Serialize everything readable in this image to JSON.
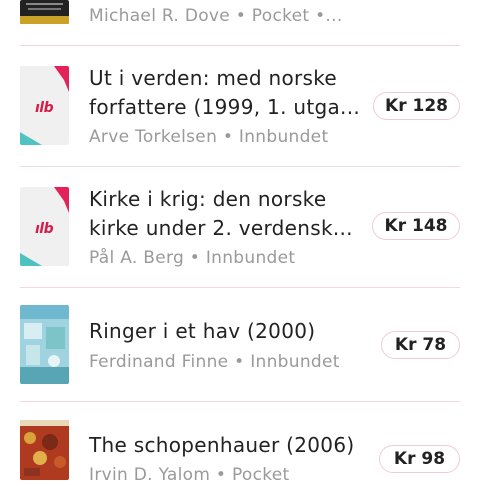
{
  "colors": {
    "accent": "#e3225a",
    "teal": "#4ec1c1",
    "divider": "#f7d7de"
  },
  "items": [
    {
      "title": "",
      "author": "Michael R. Dove",
      "format": "Pocket",
      "suffix": "•...",
      "price": ""
    },
    {
      "title": "Ut i verden: med norske forfattere (1999, 1. utga...",
      "author": "Arve Torkelsen",
      "format": "Innbundet",
      "price": "Kr 128",
      "cover_logo": "ılb"
    },
    {
      "title": "Kirke i krig: den norske kirke under 2. verdensk...",
      "author": "Pål A. Berg",
      "format": "Innbundet",
      "price": "Kr 148",
      "cover_logo": "ılb"
    },
    {
      "title": "Ringer i et hav (2000)",
      "author": "Ferdinand Finne",
      "format": "Innbundet",
      "price": "Kr 78"
    },
    {
      "title": "The schopenhauer (2006)",
      "author": "Irvin D. Yalom",
      "format": "Pocket",
      "price": "Kr 98"
    }
  ]
}
